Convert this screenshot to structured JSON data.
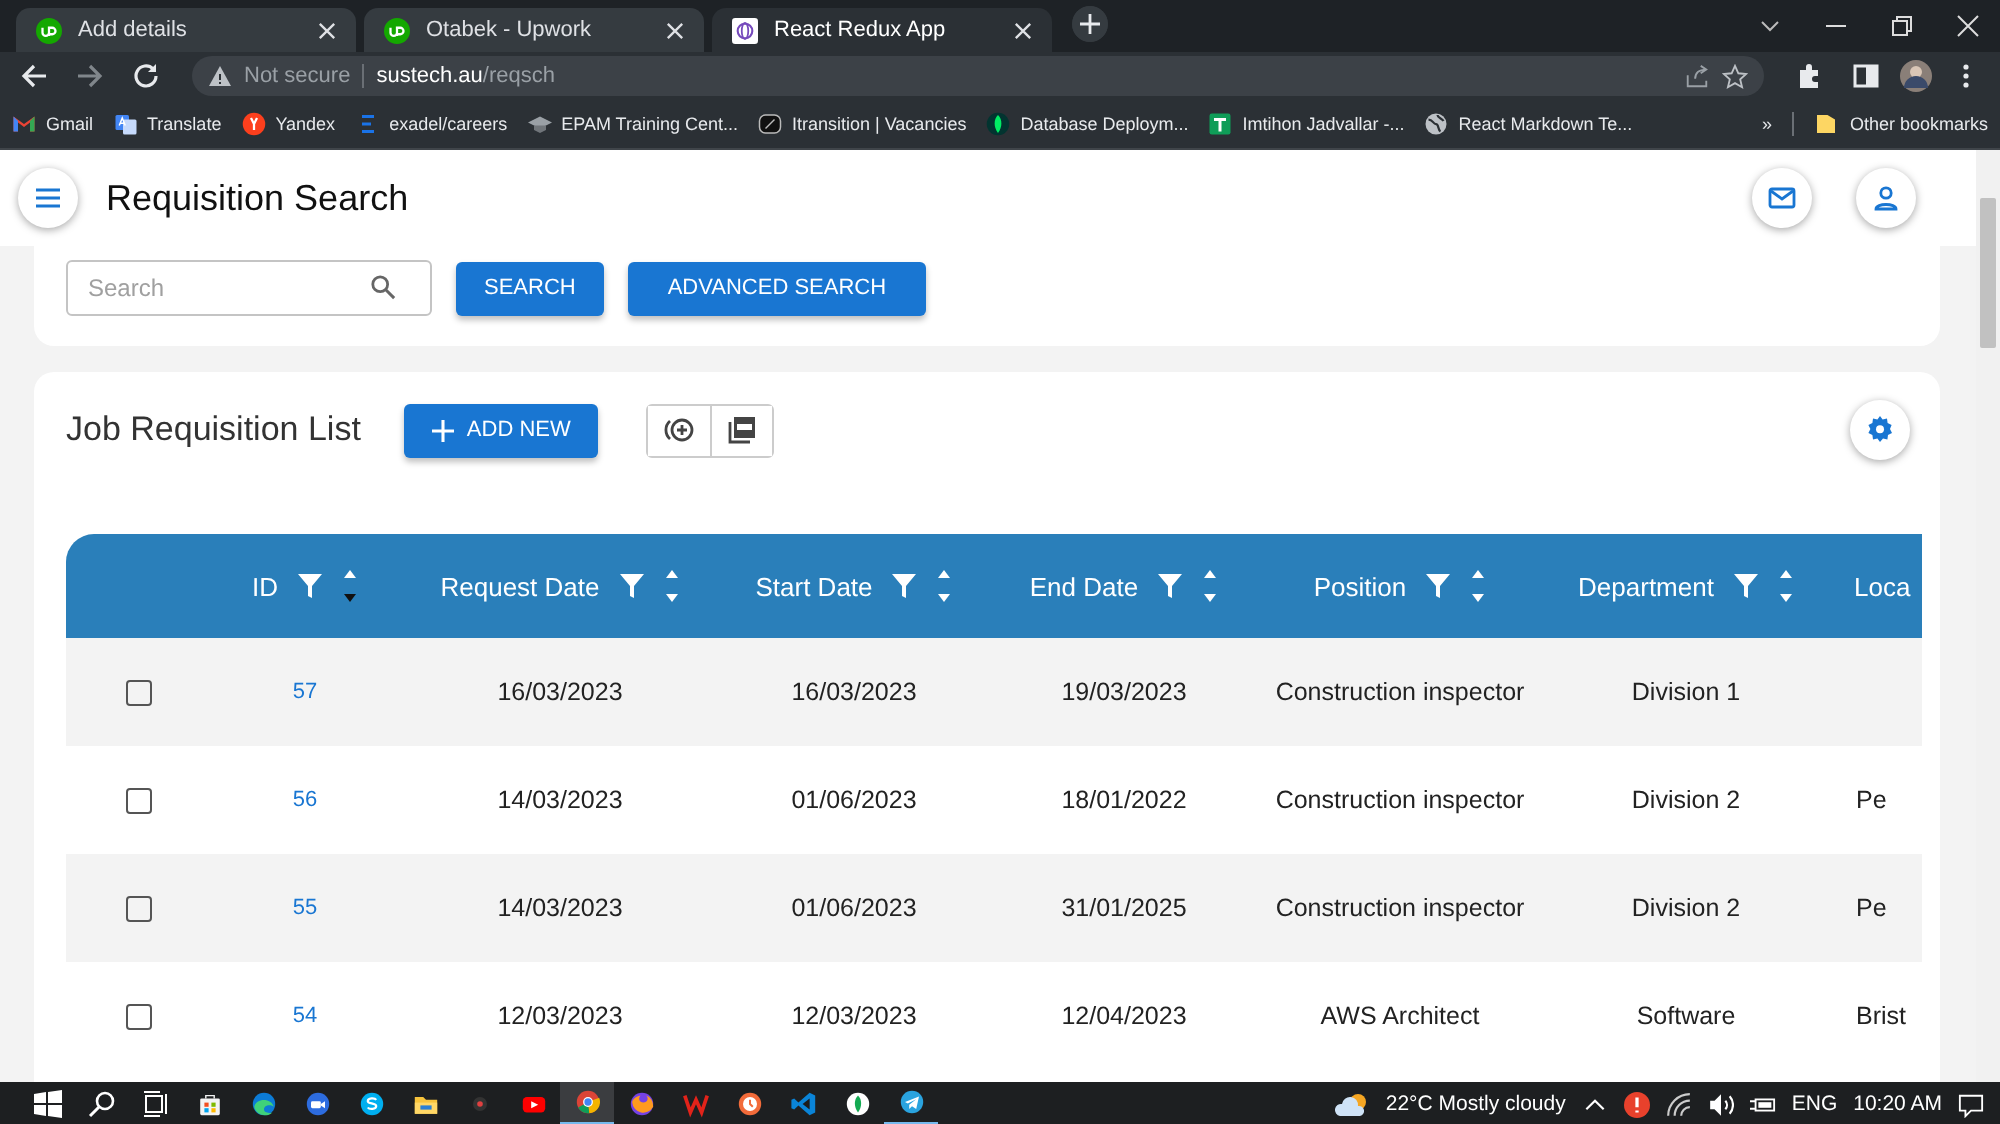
{
  "browser": {
    "tabs": [
      {
        "title": "Add details",
        "kind": "upwork",
        "selected": false
      },
      {
        "title": "Otabek - Upwork",
        "kind": "upwork",
        "selected": false
      },
      {
        "title": "React Redux App",
        "kind": "redux",
        "selected": true
      }
    ],
    "address": {
      "security": "Not secure",
      "host": "sustech.au",
      "path": "/reqsch"
    },
    "bookmarks": [
      {
        "label": "Gmail",
        "kind": "mail"
      },
      {
        "label": "Translate",
        "kind": "translate"
      },
      {
        "label": "Yandex",
        "kind": "yandex"
      },
      {
        "label": "exadel/careers",
        "kind": "bars"
      },
      {
        "label": "EPAM Training Cent...",
        "kind": "cap"
      },
      {
        "label": "Itransition | Vacancies",
        "kind": "dark"
      },
      {
        "label": "Database Deploym...",
        "kind": "leaf"
      },
      {
        "label": "Imtihon Jadvallar -...",
        "kind": "sheet"
      },
      {
        "label": "React Markdown Te...",
        "kind": "globe"
      }
    ],
    "overflow": "»",
    "other_bookmarks": "Other bookmarks"
  },
  "app": {
    "title": "Requisition Search",
    "search": {
      "placeholder": "Search"
    },
    "search_buttons": [
      "SEARCH",
      "ADVANCED SEARCH"
    ],
    "list_title": "Job Requisition List",
    "add_button": "ADD NEW",
    "table": {
      "columns": [
        {
          "label": "ID",
          "sorted_descending": true
        },
        {
          "label": "Request Date",
          "sorted_descending": false
        },
        {
          "label": "Start Date",
          "sorted_descending": false
        },
        {
          "label": "End Date",
          "sorted_descending": false
        },
        {
          "label": "Position",
          "sorted_descending": false
        },
        {
          "label": "Department",
          "sorted_descending": false
        },
        {
          "label": "Loca"
        }
      ],
      "rows": [
        {
          "checked": false,
          "cells": [
            "57",
            "16/03/2023",
            "16/03/2023",
            "19/03/2023",
            "Construction inspector",
            "Division 1",
            ""
          ]
        },
        {
          "checked": false,
          "cells": [
            "56",
            "14/03/2023",
            "01/06/2023",
            "18/01/2022",
            "Construction inspector",
            "Division 2",
            "Pe"
          ]
        },
        {
          "checked": false,
          "cells": [
            "55",
            "14/03/2023",
            "01/06/2023",
            "31/01/2025",
            "Construction inspector",
            "Division 2",
            "Pe"
          ]
        },
        {
          "checked": false,
          "cells": [
            "54",
            "12/03/2023",
            "12/03/2023",
            "12/04/2023",
            "AWS Architect",
            "Software",
            "Brist"
          ]
        }
      ]
    }
  },
  "taskbar": {
    "apps": [
      {
        "kind": "store",
        "open": false,
        "selected": false
      },
      {
        "kind": "edge",
        "open": false,
        "selected": false
      },
      {
        "kind": "meeting",
        "open": false,
        "selected": false
      },
      {
        "kind": "skype",
        "open": false,
        "selected": false
      },
      {
        "kind": "files",
        "open": false,
        "selected": false
      },
      {
        "kind": "recorder",
        "open": false,
        "selected": false
      },
      {
        "kind": "video",
        "open": false,
        "selected": false
      },
      {
        "kind": "chrome",
        "open": true,
        "selected": true
      },
      {
        "kind": "firefox",
        "open": false,
        "selected": false
      },
      {
        "kind": "office",
        "open": false,
        "selected": false
      },
      {
        "kind": "clock",
        "open": false,
        "selected": false
      },
      {
        "kind": "code",
        "open": false,
        "selected": false
      },
      {
        "kind": "leaf",
        "open": false,
        "selected": false
      },
      {
        "kind": "telegram",
        "open": true,
        "selected": false
      }
    ],
    "temperature": "22°C",
    "weather": "Mostly cloudy",
    "language": "ENG",
    "time": "10:20 AM"
  }
}
